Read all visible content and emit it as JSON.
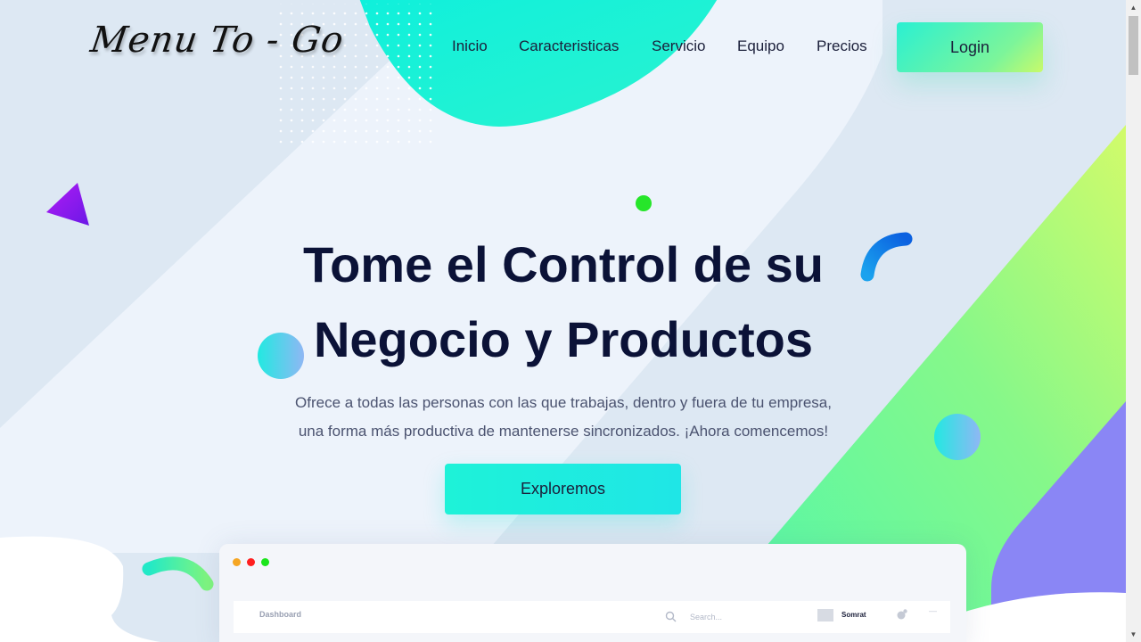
{
  "brand": {
    "logo_text": "Menu To - Go"
  },
  "nav": {
    "items": [
      {
        "label": "Inicio"
      },
      {
        "label": "Caracteristicas"
      },
      {
        "label": "Servicio"
      },
      {
        "label": "Equipo"
      },
      {
        "label": "Precios"
      }
    ],
    "login_label": "Login"
  },
  "hero": {
    "title_line1": "Tome el Control de su",
    "title_line2": "Negocio y Productos",
    "subtitle_line1": "Ofrece a todas las personas con las que trabajas, dentro y fuera de tu empresa,",
    "subtitle_line2": "una forma más productiva de mantenerse sincronizados. ¡Ahora comencemos!",
    "cta_label": "Exploremos"
  },
  "dashboard": {
    "title": "Dashboard",
    "search_placeholder": "Search...",
    "user_name": "Somrat",
    "window_dot_colors": [
      "#f5a623",
      "#ff1f1f",
      "#1be51b"
    ]
  },
  "colors": {
    "accent_cyan": "#1ef2d8",
    "accent_green": "#7cf59a",
    "accent_lime": "#c8fa6a",
    "accent_purple": "#8a86f5",
    "title_navy": "#0b1237"
  }
}
